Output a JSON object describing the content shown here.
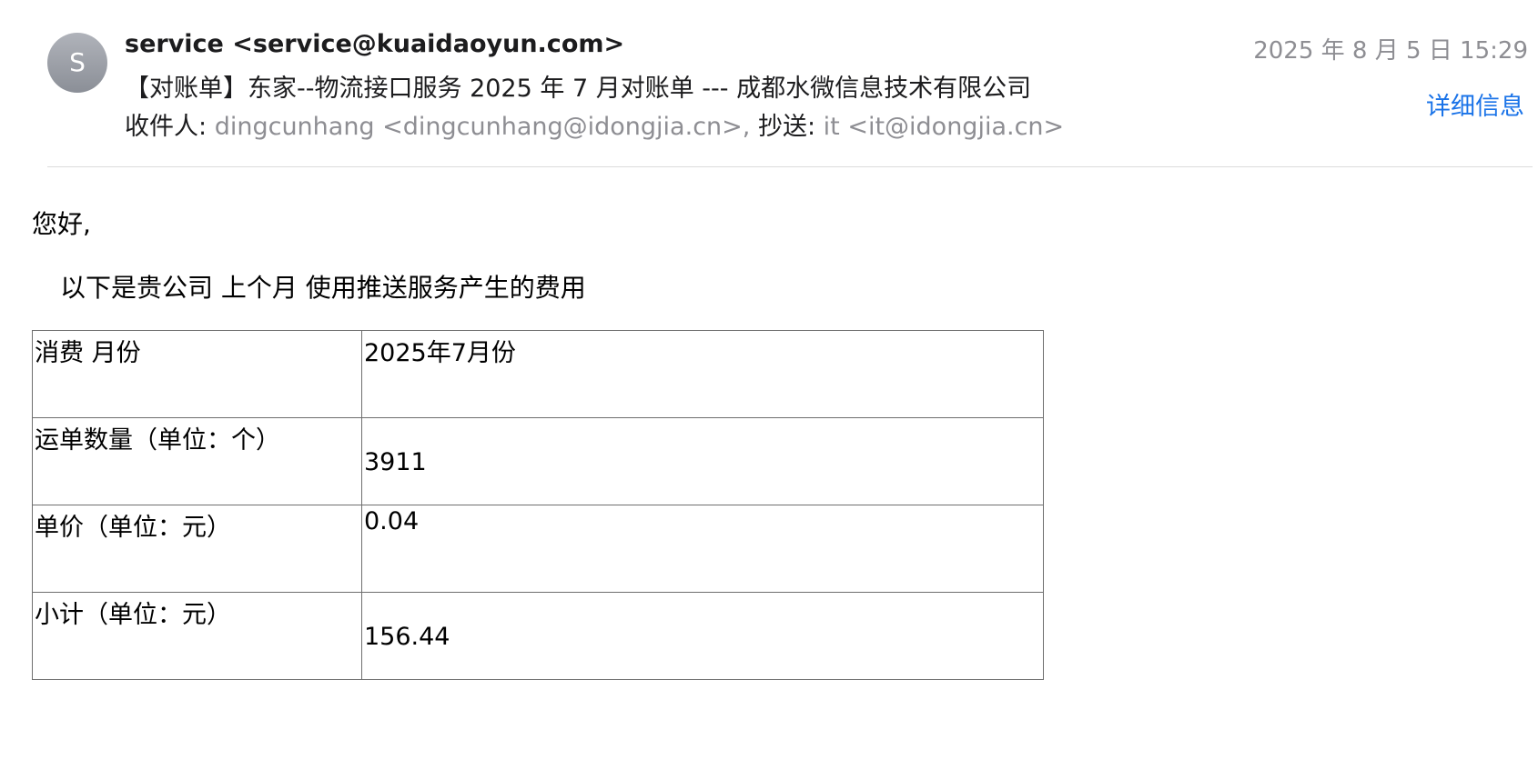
{
  "header": {
    "avatar_letter": "S",
    "sender": "service <service@kuaidaoyun.com>",
    "subject": "【对账单】东家--物流接口服务 2025 年 7 月对账单 --- 成都水微信息技术有限公司",
    "to_label": "收件人:",
    "to_value": "dingcunhang <dingcunhang@idongjia.cn>,",
    "cc_label": "抄送:",
    "cc_value": "it <it@idongjia.cn>",
    "datetime": "2025 年 8 月 5 日 15:29",
    "details_link": "详细信息"
  },
  "body": {
    "greeting": "您好,",
    "intro": "以下是贵公司 上个月 使用推送服务产生的费用",
    "table": [
      {
        "label": "消费 月份",
        "value": "2025年7月份"
      },
      {
        "label": "运单数量（单位：个）",
        "value": "3911"
      },
      {
        "label": "单价（单位：元）",
        "value": "0.04"
      },
      {
        "label": "小计（单位：元）",
        "value": "156.44"
      }
    ]
  },
  "colors": {
    "link": "#1a73e8",
    "muted": "#8e8e93",
    "text": "#1c1c1e"
  }
}
